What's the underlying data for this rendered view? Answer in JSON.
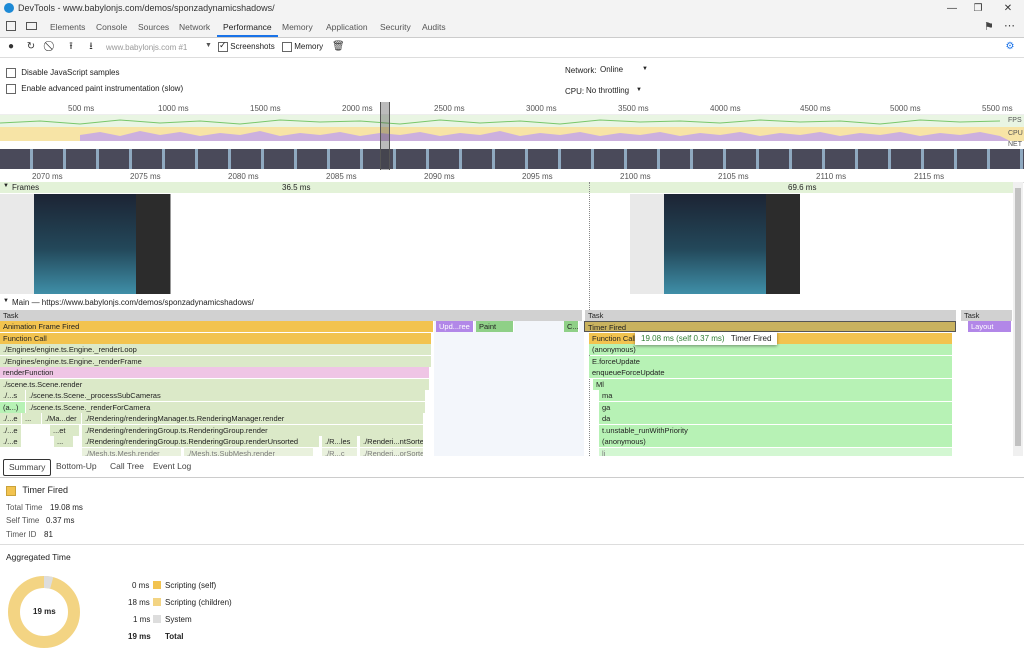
{
  "window": {
    "title": "DevTools - www.babylonjs.com/demos/sponzadynamicshadows/"
  },
  "tabs": [
    "Elements",
    "Console",
    "Sources",
    "Network",
    "Performance",
    "Memory",
    "Application",
    "Security",
    "Audits"
  ],
  "active_tab": "Performance",
  "toolbar": {
    "profile_select": "www.babylonjs.com #1",
    "screenshots_label": "Screenshots",
    "memory_label": "Memory"
  },
  "settings": {
    "disable_js_samples": "Disable JavaScript samples",
    "advanced_paint": "Enable advanced paint instrumentation (slow)",
    "network_label": "Network:",
    "network_value": "Online",
    "cpu_label": "CPU:",
    "cpu_value": "No throttling"
  },
  "overview_ticks": [
    "500 ms",
    "1000 ms",
    "1500 ms",
    "2000 ms",
    "2500 ms",
    "3000 ms",
    "3500 ms",
    "4000 ms",
    "4500 ms",
    "5000 ms",
    "5500 ms"
  ],
  "overview_labels": {
    "fps": "FPS",
    "cpu": "CPU",
    "net": "NET"
  },
  "detail_ticks": [
    "2070 ms",
    "2075 ms",
    "2080 ms",
    "2085 ms",
    "2090 ms",
    "2095 ms",
    "2100 ms",
    "2105 ms",
    "2110 ms",
    "2115 ms"
  ],
  "frames": {
    "label": "Frames",
    "frame1": "36.5 ms",
    "frame2": "69.6 ms"
  },
  "main": {
    "label": "Main — https://www.babylonjs.com/demos/sponzadynamicshadows/",
    "left_rows": [
      "Task",
      "Animation Frame Fired",
      "Function Call",
      "./Engines/engine.ts.Engine._renderLoop",
      "./Engines/engine.ts.Engine._renderFrame",
      "renderFunction",
      "./scene.ts.Scene.render",
      "./scene.ts.Scene._processSubCameras",
      "./scene.ts.Scene._renderForCamera",
      "./Rendering/renderingManager.ts.RenderingManager.render",
      "./Rendering/renderingGroup.ts.RenderingGroup.render",
      "./Rendering/renderingGroup.ts.RenderingGroup.renderUnsorted"
    ],
    "left_prefix": [
      "./...s",
      "(a...)",
      "./...e",
      "./...e",
      "./...e"
    ],
    "small_labels": {
      "upd": "Upd...ree",
      "paint": "Paint",
      "c": "C...",
      "ma": "./Ma...der",
      "et": "...et",
      "dots": "...",
      "r_les": "./R...les",
      "renderi": "./Renderi...ntSorted",
      "mesh_render": "./Mesh.ts.Mesh.render",
      "submesh": "./Mesh.ts.SubMesh.render",
      "r_c": "./R...c",
      "renderi2": "./Renderi...orSorted"
    },
    "right_rows": [
      "Task",
      "Timer Fired",
      "Function Call",
      "(anonymous)",
      "E.forceUpdate",
      "enqueueForceUpdate",
      "Ml",
      "ma",
      "ga",
      "da",
      "t.unstable_runWithPriority",
      "(anonymous)",
      "li"
    ],
    "far_right": {
      "task": "Task",
      "layout": "Layout"
    },
    "tooltip": {
      "time": "19.08 ms (self 0.37 ms)",
      "label": "Timer Fired"
    }
  },
  "bottom_tabs": [
    "Summary",
    "Bottom-Up",
    "Call Tree",
    "Event Log"
  ],
  "summary": {
    "event": "Timer Fired",
    "total_time_label": "Total Time",
    "total_time": "19.08 ms",
    "self_time_label": "Self Time",
    "self_time": "0.37 ms",
    "timer_id_label": "Timer ID",
    "timer_id": "81",
    "aggregated_title": "Aggregated Time",
    "donut_center": "19 ms",
    "legend": [
      {
        "value": "0 ms",
        "label": "Scripting (self)",
        "color": "#f2c34f"
      },
      {
        "value": "18 ms",
        "label": "Scripting (children)",
        "color": "#f3d483"
      },
      {
        "value": "1 ms",
        "label": "System",
        "color": "#dddddd"
      },
      {
        "value": "19 ms",
        "label": "Total",
        "color": ""
      }
    ]
  }
}
